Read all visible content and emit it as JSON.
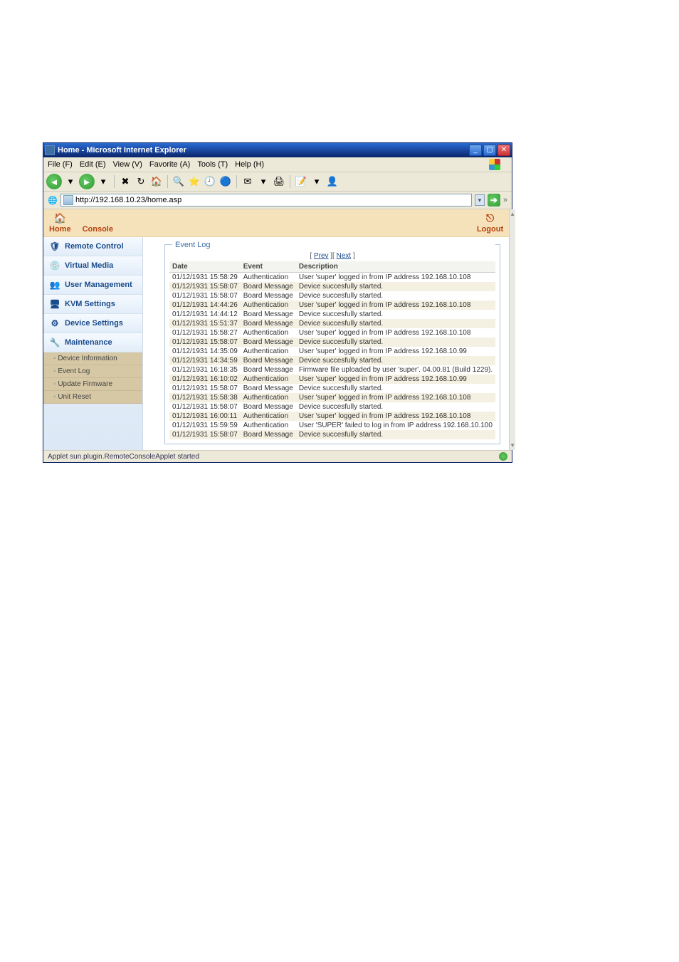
{
  "window": {
    "title": "Home - Microsoft Internet Explorer",
    "controls": {
      "min": "_",
      "max": "▢",
      "close": "✕"
    }
  },
  "menubar": {
    "file": "File (F)",
    "edit": "Edit (E)",
    "view": "View (V)",
    "favorites": "Favorite (A)",
    "tools": "Tools (T)",
    "help": "Help (H)"
  },
  "addressbar": {
    "url": "http://192.168.10.23/home.asp",
    "links_label": "»"
  },
  "header": {
    "home": "Home",
    "console": "Console",
    "logout": "Logout"
  },
  "sidebar": {
    "items": [
      {
        "icon": "🛡",
        "label": "Remote Control"
      },
      {
        "icon": "💿",
        "label": "Virtual Media"
      },
      {
        "icon": "👥",
        "label": "User Management"
      },
      {
        "icon": "🖥",
        "label": "KVM Settings"
      },
      {
        "icon": "⚙",
        "label": "Device Settings"
      },
      {
        "icon": "🔧",
        "label": "Maintenance"
      }
    ],
    "sub": [
      {
        "label": "Device Information"
      },
      {
        "label": "Event Log"
      },
      {
        "label": "Update Firmware"
      },
      {
        "label": "Unit Reset"
      }
    ]
  },
  "eventlog": {
    "legend": "Event Log",
    "pager_prev": "Prev",
    "pager_next": "Next",
    "pager_raw": "[ Prev ][ Next ]",
    "columns": {
      "date": "Date",
      "event": "Event",
      "desc": "Description"
    },
    "rows": [
      {
        "date": "01/12/1931 15:58:29",
        "event": "Authentication",
        "desc": "User 'super' logged in from IP address 192.168.10.108"
      },
      {
        "date": "01/12/1931 15:58:07",
        "event": "Board Message",
        "desc": "Device succesfully started."
      },
      {
        "date": "01/12/1931 15:58:07",
        "event": "Board Message",
        "desc": "Device succesfully started."
      },
      {
        "date": "01/12/1931 14:44:26",
        "event": "Authentication",
        "desc": "User 'super' logged in from IP address 192.168.10.108"
      },
      {
        "date": "01/12/1931 14:44:12",
        "event": "Board Message",
        "desc": "Device succesfully started."
      },
      {
        "date": "01/12/1931 15:51:37",
        "event": "Board Message",
        "desc": "Device succesfully started."
      },
      {
        "date": "01/12/1931 15:58:27",
        "event": "Authentication",
        "desc": "User 'super' logged in from IP address 192.168.10.108"
      },
      {
        "date": "01/12/1931 15:58:07",
        "event": "Board Message",
        "desc": "Device succesfully started."
      },
      {
        "date": "01/12/1931 14:35:09",
        "event": "Authentication",
        "desc": "User 'super' logged in from IP address 192.168.10.99"
      },
      {
        "date": "01/12/1931 14:34:59",
        "event": "Board Message",
        "desc": "Device succesfully started."
      },
      {
        "date": "01/12/1931 16:18:35",
        "event": "Board Message",
        "desc": "Firmware file uploaded by user 'super'. 04.00.81 (Build 1229)."
      },
      {
        "date": "01/12/1931 16:10:02",
        "event": "Authentication",
        "desc": "User 'super' logged in from IP address 192.168.10.99"
      },
      {
        "date": "01/12/1931 15:58:07",
        "event": "Board Message",
        "desc": "Device succesfully started."
      },
      {
        "date": "01/12/1931 15:58:38",
        "event": "Authentication",
        "desc": "User 'super' logged in from IP address 192.168.10.108"
      },
      {
        "date": "01/12/1931 15:58:07",
        "event": "Board Message",
        "desc": "Device succesfully started."
      },
      {
        "date": "01/12/1931 16:00:11",
        "event": "Authentication",
        "desc": "User 'super' logged in from IP address 192.168.10.108"
      },
      {
        "date": "01/12/1931 15:59:59",
        "event": "Authentication",
        "desc": "User 'SUPER' failed to log in from IP address 192.168.10.100"
      },
      {
        "date": "01/12/1931 15:58:07",
        "event": "Board Message",
        "desc": "Device succesfully started."
      }
    ]
  },
  "statusbar": {
    "text": "Applet sun.plugin.RemoteConsoleApplet started"
  }
}
